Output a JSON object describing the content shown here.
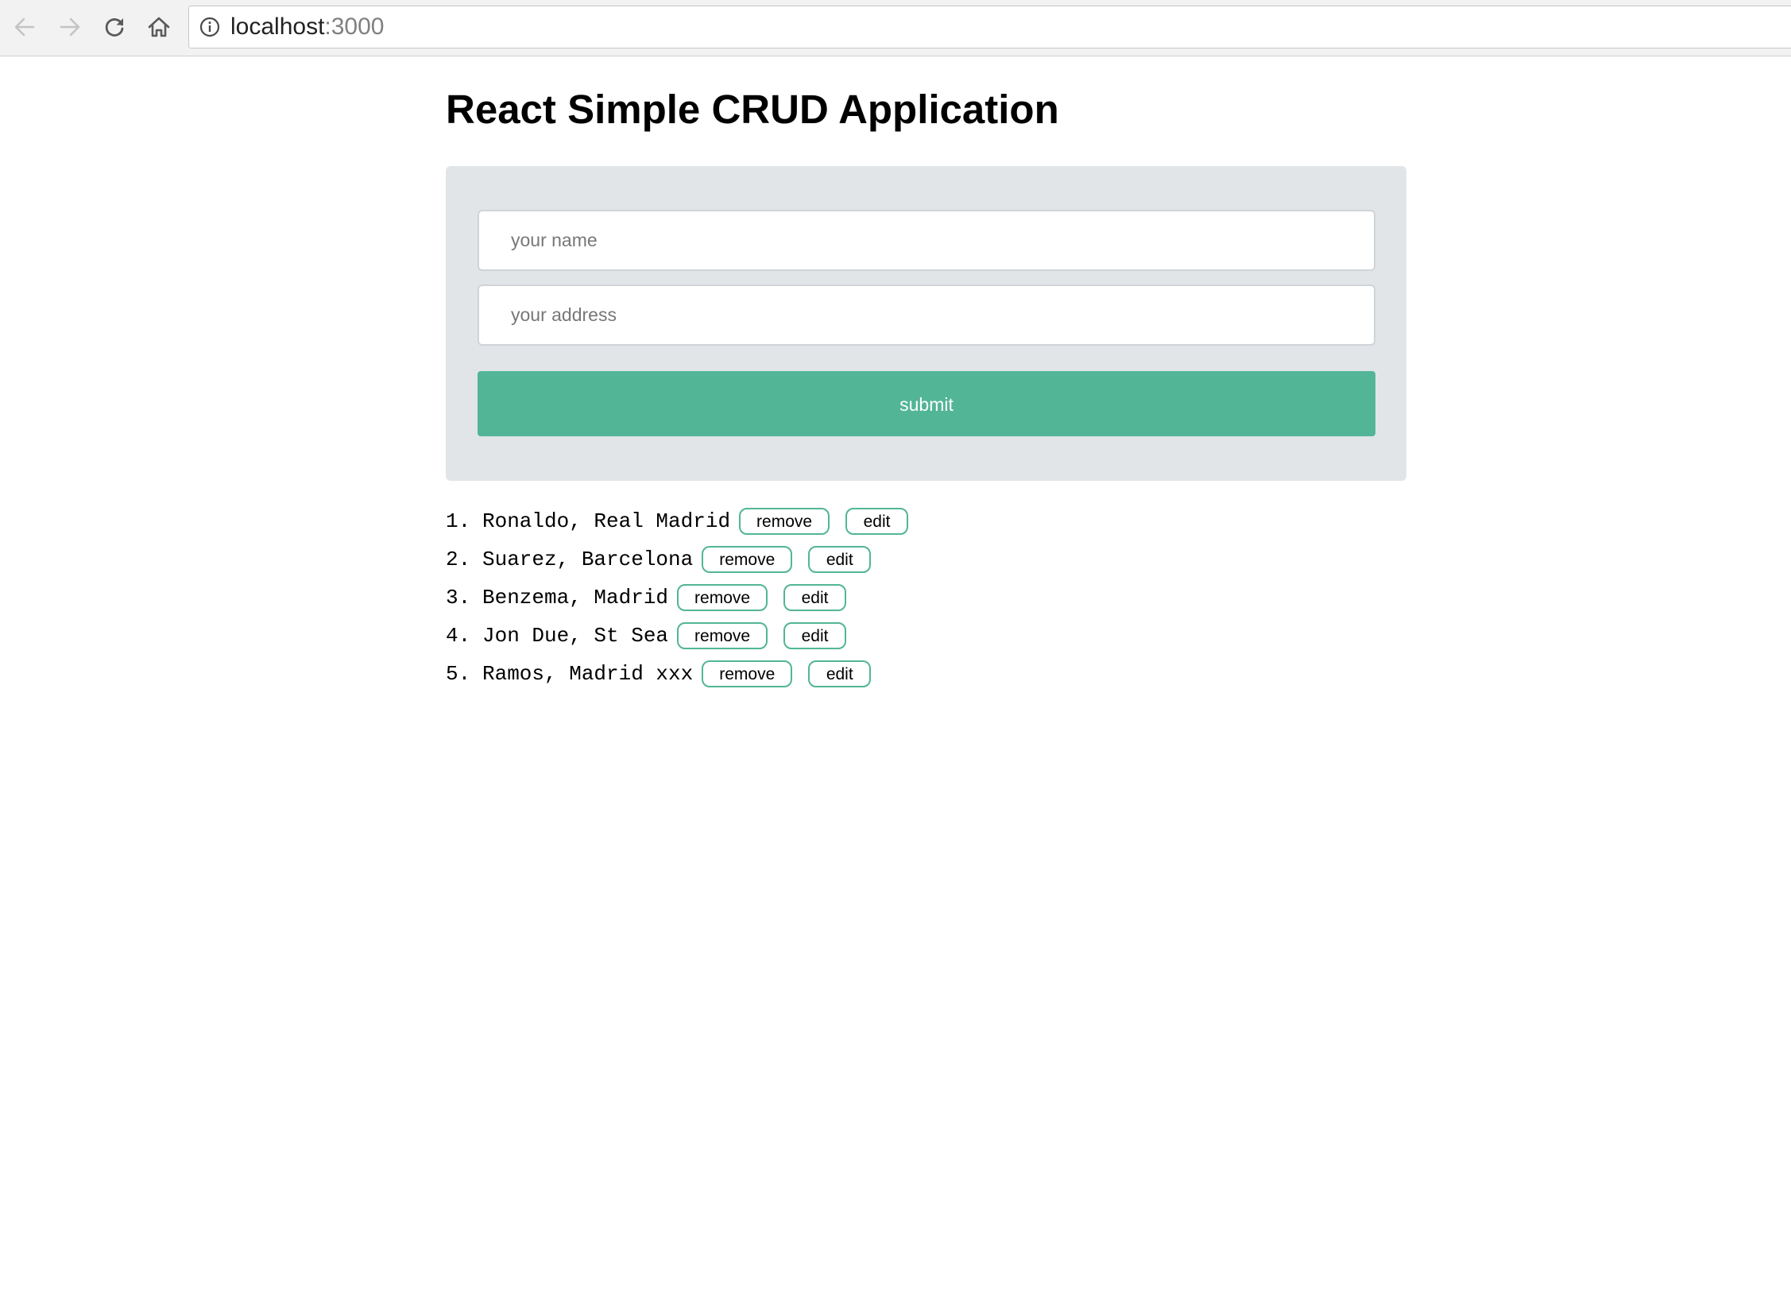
{
  "browser": {
    "url_host": "localhost",
    "url_port": ":3000"
  },
  "page": {
    "title": "React Simple CRUD Application"
  },
  "form": {
    "name_placeholder": "your name",
    "name_value": "",
    "address_placeholder": "your address",
    "address_value": "",
    "submit_label": "submit"
  },
  "people": [
    {
      "number": "1.",
      "text": "Ronaldo, Real Madrid",
      "remove_label": "remove",
      "edit_label": "edit"
    },
    {
      "number": "2.",
      "text": "Suarez, Barcelona",
      "remove_label": "remove",
      "edit_label": "edit"
    },
    {
      "number": "3.",
      "text": "Benzema, Madrid",
      "remove_label": "remove",
      "edit_label": "edit"
    },
    {
      "number": "4.",
      "text": "Jon Due, St Sea",
      "remove_label": "remove",
      "edit_label": "edit"
    },
    {
      "number": "5.",
      "text": "Ramos, Madrid xxx",
      "remove_label": "remove",
      "edit_label": "edit"
    }
  ],
  "colors": {
    "accent": "#52b596",
    "panel_background": "#e1e5e8",
    "toolbar_background": "#f2f2f2"
  },
  "icons": {
    "back": "arrow-left-icon",
    "forward": "arrow-right-icon",
    "reload": "reload-icon",
    "home": "home-icon",
    "site_info": "info-icon"
  }
}
